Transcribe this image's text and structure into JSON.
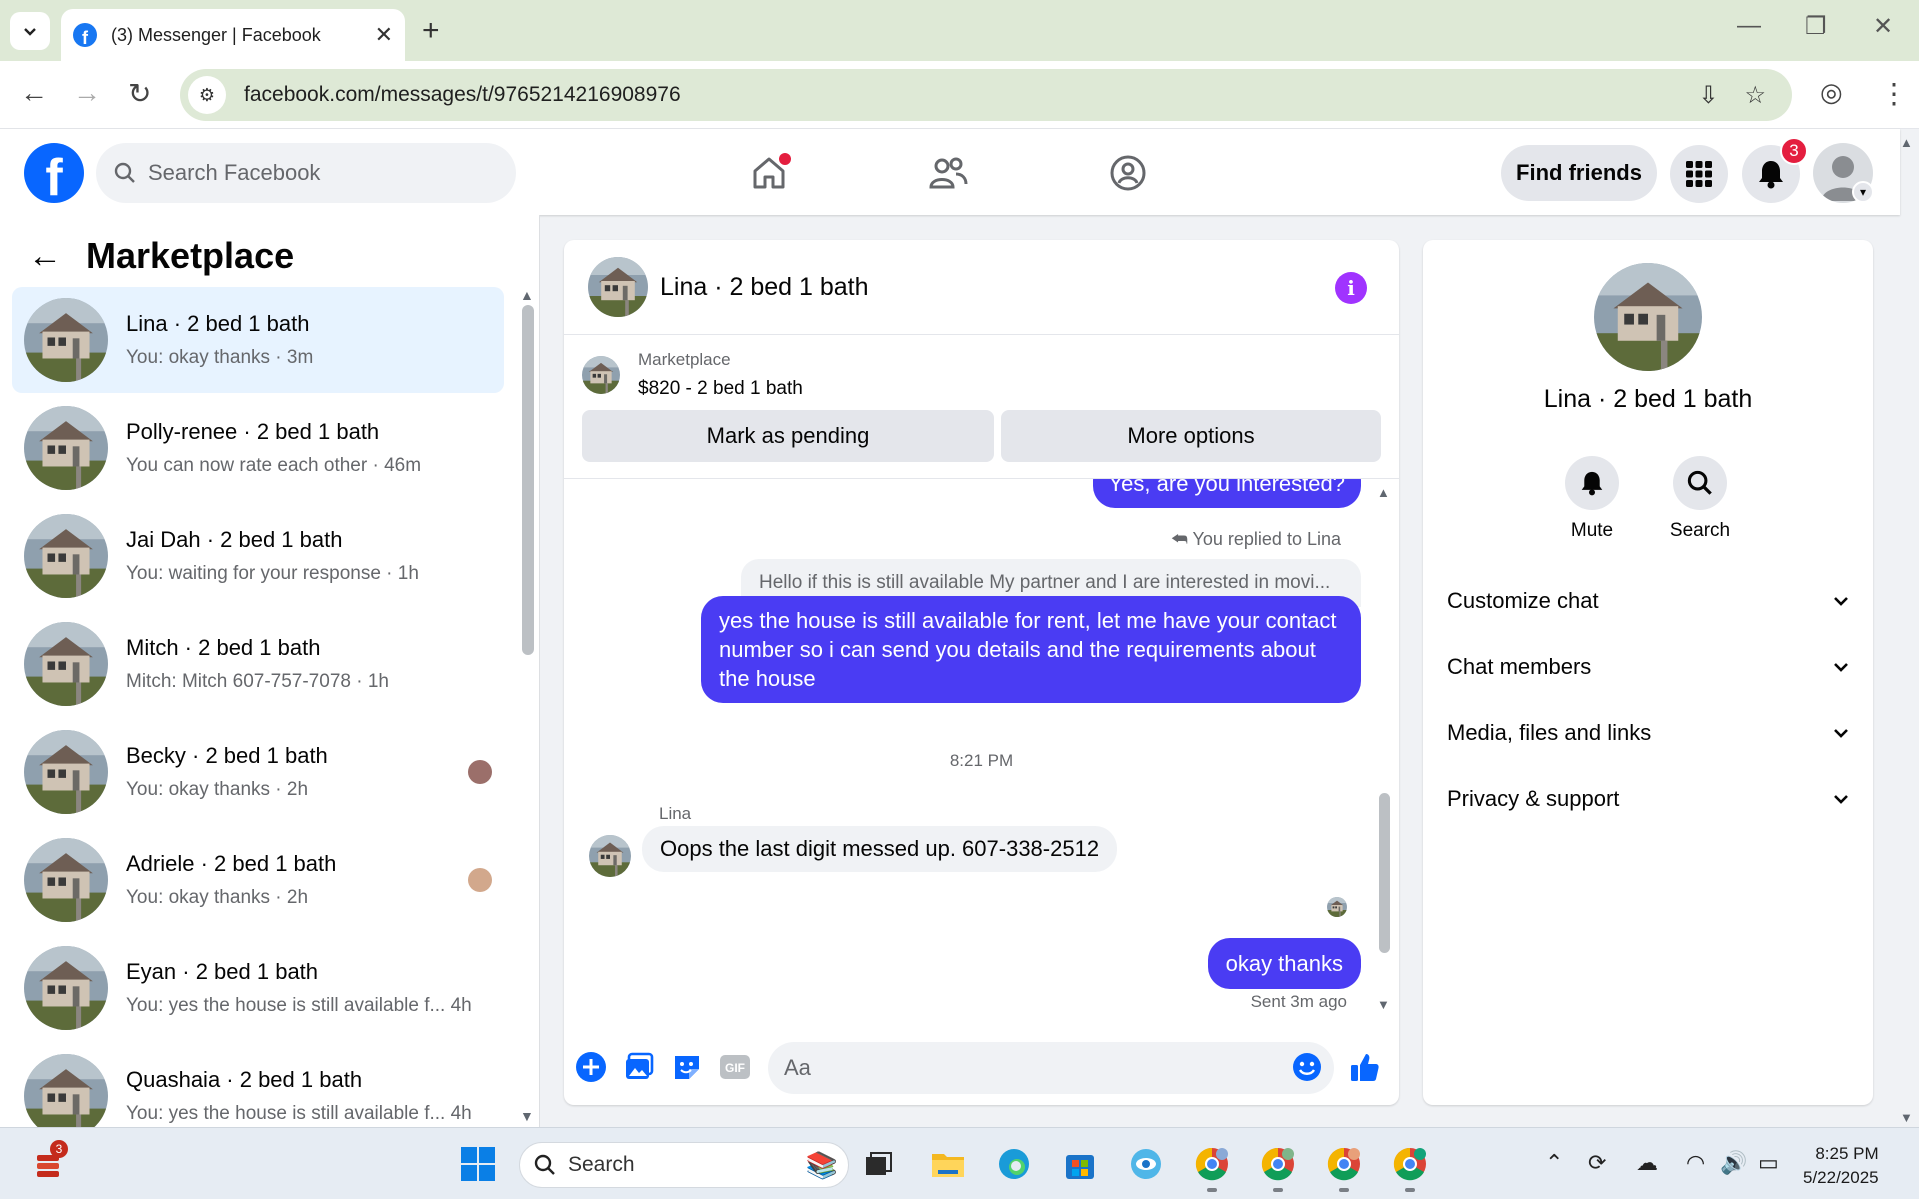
{
  "browser": {
    "tab_title": "(3) Messenger | Facebook",
    "url": "facebook.com/messages/t/9765214216908976"
  },
  "fb_header": {
    "search_placeholder": "Search Facebook",
    "find_friends_label": "Find friends",
    "notification_count": "3"
  },
  "left_panel": {
    "title": "Marketplace",
    "conversations": [
      {
        "name": "Lina · 2 bed 1 bath",
        "preview": "You: okay thanks · 3m",
        "active": true
      },
      {
        "name": "Polly-renee · 2 bed 1 bath",
        "preview": "You can now rate each other · 46m"
      },
      {
        "name": "Jai Dah · 2 bed 1 bath",
        "preview": "You: waiting for your response · 1h"
      },
      {
        "name": "Mitch · 2 bed 1 bath",
        "preview": "Mitch: Mitch 607-757-7078 · 1h"
      },
      {
        "name": "Becky · 2 bed 1 bath",
        "preview": "You: okay thanks · 2h"
      },
      {
        "name": "Adriele · 2 bed 1 bath",
        "preview": "You: okay thanks · 2h"
      },
      {
        "name": "Eyan · 2 bed 1 bath",
        "preview": "You: yes the house is still available f... 4h"
      },
      {
        "name": "Quashaia · 2 bed 1 bath",
        "preview": "You: yes the house is still available f... 4h"
      }
    ]
  },
  "chat": {
    "title": "Lina · 2 bed 1 bath",
    "listing_kind": "Marketplace",
    "listing_price": "$820 - 2 bed 1 bath",
    "mark_pending_label": "Mark as pending",
    "more_options_label": "More options",
    "partial_message": "Yes, are you interested?",
    "replied_label": "You replied to Lina",
    "quoted_message": "Hello if this is still available My partner and I are interested in movi...",
    "reply_message": "yes the house is still available for rent, let me have your contact number so i can send you details and the requirements about the house",
    "timestamp": "8:21 PM",
    "incoming_sender": "Lina",
    "incoming_message": "Oops the last digit messed up. 607-338-2512",
    "outgoing_message": "okay thanks",
    "sent_status": "Sent 3m ago",
    "composer_placeholder": "Aa",
    "composer_gif_label": "GIF"
  },
  "right_panel": {
    "name": "Lina · 2 bed 1 bath",
    "mute_label": "Mute",
    "search_label": "Search",
    "sections": [
      "Customize chat",
      "Chat members",
      "Media, files and links",
      "Privacy & support"
    ]
  },
  "taskbar": {
    "widget_badge": "3",
    "search_placeholder": "Search",
    "time": "8:25 PM",
    "date": "5/22/2025"
  },
  "colors": {
    "fb_blue": "#0866ff",
    "messenger_bubble": "#4a3cf3",
    "active_conv": "#e7f3ff",
    "info_purple": "#a033ff",
    "badge_red": "#e41e3f"
  }
}
